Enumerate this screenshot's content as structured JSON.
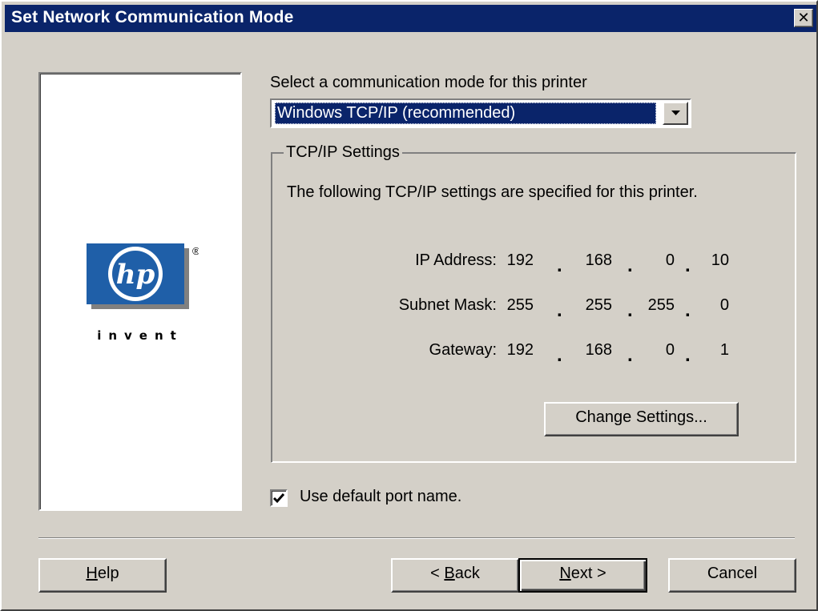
{
  "window": {
    "title": "Set Network Communication Mode",
    "close_glyph": "✕"
  },
  "branding": {
    "logo_text": "hp",
    "registered_mark": "®",
    "tagline": "invent",
    "logo_color": "#1f5fa8"
  },
  "mode": {
    "prompt": "Select a communication mode for this printer",
    "selected_value": "Windows TCP/IP  (recommended)"
  },
  "tcpip": {
    "group_title": "TCP/IP Settings",
    "description": "The following TCP/IP settings are specified for this printer.",
    "rows": [
      {
        "label": "IP Address:",
        "octets": [
          "192",
          "168",
          "0",
          "10"
        ]
      },
      {
        "label": "Subnet Mask:",
        "octets": [
          "255",
          "255",
          "255",
          "0"
        ]
      },
      {
        "label": "Gateway:",
        "octets": [
          "192",
          "168",
          "0",
          "1"
        ]
      }
    ],
    "change_button": "Change Settings..."
  },
  "options": {
    "default_port_label": "Use default port name.",
    "default_port_checked": true
  },
  "buttons": {
    "help_accel": "H",
    "help_rest": "elp",
    "back_prefix": "< ",
    "back_accel": "B",
    "back_rest": "ack",
    "next_accel": "N",
    "next_rest": "ext >",
    "cancel": "Cancel"
  },
  "colors": {
    "titlebar": "#0a246a",
    "dialog_face": "#d4d0c8",
    "selection": "#0a246a"
  }
}
